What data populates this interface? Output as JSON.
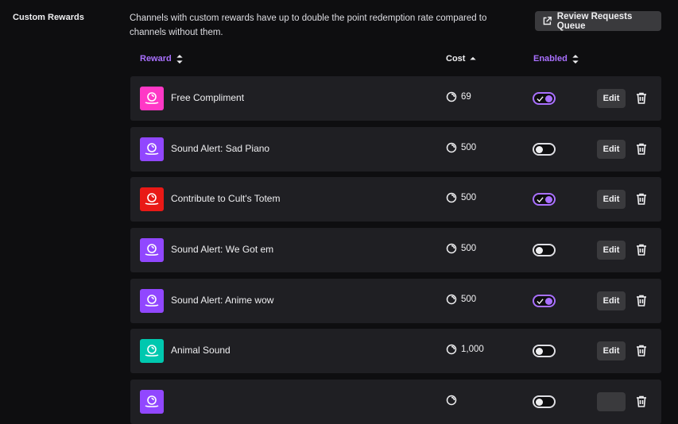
{
  "section": {
    "title": "Custom Rewards"
  },
  "description": "Channels with custom rewards have up to double the point redemption rate compared to channels without them.",
  "review_button": {
    "label": "Review Requests Queue",
    "icon": "external-link-icon"
  },
  "columns": {
    "reward": "Reward",
    "cost": "Cost",
    "enabled": "Enabled"
  },
  "colors": {
    "accent": "#a970ff",
    "pink": "#ff38c6",
    "purple": "#9147ff",
    "red": "#e91916",
    "teal": "#00c8af"
  },
  "rewards": [
    {
      "name": "Free Compliment",
      "cost": "69",
      "enabled": true,
      "color": "#ff38c6",
      "edit": "Edit"
    },
    {
      "name": "Sound Alert: Sad Piano",
      "cost": "500",
      "enabled": false,
      "color": "#9147ff",
      "edit": "Edit"
    },
    {
      "name": "Contribute to Cult's Totem",
      "cost": "500",
      "enabled": true,
      "color": "#e91916",
      "edit": "Edit"
    },
    {
      "name": "Sound Alert: We Got em",
      "cost": "500",
      "enabled": false,
      "color": "#9147ff",
      "edit": "Edit"
    },
    {
      "name": "Sound Alert: Anime wow",
      "cost": "500",
      "enabled": true,
      "color": "#9147ff",
      "edit": "Edit"
    },
    {
      "name": "Animal Sound",
      "cost": "1,000",
      "enabled": false,
      "color": "#00c8af",
      "edit": "Edit"
    },
    {
      "name": "",
      "cost": "",
      "enabled": false,
      "color": "#9147ff",
      "edit": ""
    }
  ]
}
